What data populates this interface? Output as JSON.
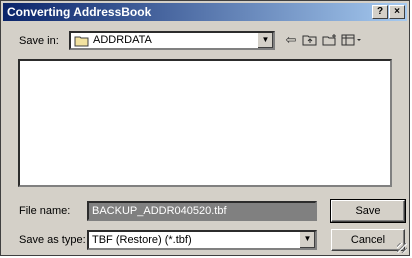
{
  "window": {
    "title": "Converting AddressBook",
    "help_label": "?",
    "close_label": "×"
  },
  "save_in": {
    "label": "Save in:",
    "value": "ADDRDATA"
  },
  "toolbar": {
    "back_icon": "back-arrow-icon",
    "up_icon": "up-folder-icon",
    "new_folder_icon": "new-folder-icon",
    "views_icon": "views-menu-icon"
  },
  "file_name": {
    "label": "File name:",
    "value": "BACKUP_ADDR040520.tbf"
  },
  "save_type": {
    "label": "Save as type:",
    "value": "TBF (Restore) (*.tbf)"
  },
  "buttons": {
    "save": "Save",
    "cancel": "Cancel"
  }
}
